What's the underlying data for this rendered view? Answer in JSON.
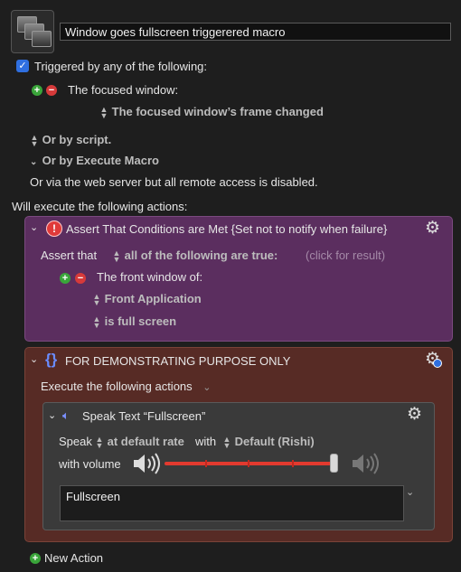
{
  "macro": {
    "name": "Window goes fullscreen triggerered macro"
  },
  "triggers": {
    "header": "Triggered by any of the following:",
    "focused_window": {
      "label": "The focused window:",
      "condition": "The focused window’s frame changed"
    },
    "by_script": "Or by script.",
    "by_execute_macro": "Or by Execute Macro",
    "web_server": "Or via the web server but all remote access is disabled."
  },
  "actions_header": "Will execute the following actions:",
  "assert_action": {
    "title": "Assert That Conditions are Met {Set not to notify when failure}",
    "assert_label": "Assert that",
    "assert_mode": "all of the following are true:",
    "result_hint": "(click for result)",
    "condition_label": "The front window of:",
    "application": "Front Application",
    "state": "is full screen"
  },
  "group_action": {
    "title": "FOR DEMONSTRATING PURPOSE ONLY",
    "execute_label": "Execute the following actions",
    "speak": {
      "title": "Speak Text “Fullscreen”",
      "speak_label": "Speak",
      "rate": "at default rate",
      "with_label": "with",
      "voice": "Default (Rishi)",
      "volume_label": "with volume",
      "volume_fraction": 1.0,
      "text": "Fullscreen"
    }
  },
  "new_action_label": "New Action",
  "colors": {
    "assert_panel": "#5b2e5f",
    "group_panel": "#572b25",
    "slider": "#e23a2f",
    "accent_blue": "#2f6fe0"
  }
}
